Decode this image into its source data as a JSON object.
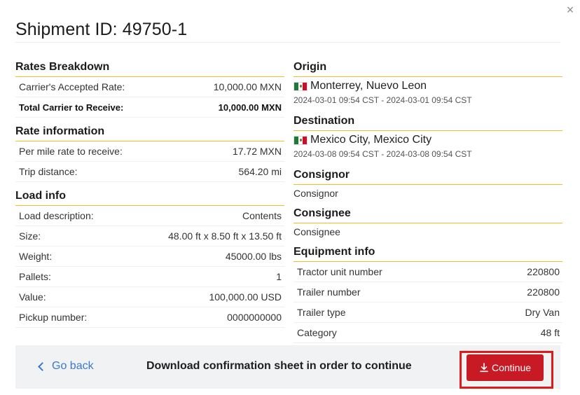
{
  "modal": {
    "title": "Shipment ID: 49750-1",
    "close_glyph": "×"
  },
  "rates_breakdown": {
    "heading": "Rates Breakdown",
    "rows": [
      {
        "label": "Carrier's Accepted Rate:",
        "value": "10,000.00 MXN"
      },
      {
        "label": "Total Carrier to Receive:",
        "value": "10,000.00 MXN"
      }
    ]
  },
  "rate_information": {
    "heading": "Rate information",
    "rows": [
      {
        "label": "Per mile rate to receive:",
        "value": "17.72 MXN"
      },
      {
        "label": "Trip distance:",
        "value": "564.20 mi"
      }
    ]
  },
  "load_info": {
    "heading": "Load info",
    "rows": [
      {
        "label": "Load description:",
        "value": "Contents"
      },
      {
        "label": "Size:",
        "value": "48.00 ft x 8.50 ft x 13.50 ft"
      },
      {
        "label": "Weight:",
        "value": "45000.00 lbs"
      },
      {
        "label": "Pallets:",
        "value": "1"
      },
      {
        "label": "Value:",
        "value": "100,000.00 USD"
      },
      {
        "label": "Pickup number:",
        "value": "0000000000"
      }
    ]
  },
  "origin": {
    "heading": "Origin",
    "flag_icon": "mexico-flag-icon",
    "place": "Monterrey, Nuevo Leon",
    "dates": "2024-03-01 09:54 CST - 2024-03-01 09:54 CST"
  },
  "destination": {
    "heading": "Destination",
    "flag_icon": "mexico-flag-icon",
    "place": "Mexico City, Mexico City",
    "dates": "2024-03-08 09:54 CST - 2024-03-08 09:54 CST"
  },
  "consignor": {
    "heading": "Consignor",
    "value": "Consignor"
  },
  "consignee": {
    "heading": "Consignee",
    "value": "Consignee"
  },
  "equipment_info": {
    "heading": "Equipment info",
    "rows": [
      {
        "label": "Tractor unit number",
        "value": "220800"
      },
      {
        "label": "Trailer number",
        "value": "220800"
      },
      {
        "label": "Trailer type",
        "value": "Dry Van"
      },
      {
        "label": "Category",
        "value": "48 ft"
      }
    ]
  },
  "footer": {
    "go_back_label": "Go back",
    "message": "Download confirmation sheet in order to continue",
    "continue_label": "Continue",
    "continue_icon": "download-icon",
    "continue_color": "#c81a24",
    "highlight_color": "#e01a1a"
  },
  "colors": {
    "section_rule": "#f0c020",
    "link": "#3a78d0",
    "footer_bg": "#f1f2f4"
  }
}
